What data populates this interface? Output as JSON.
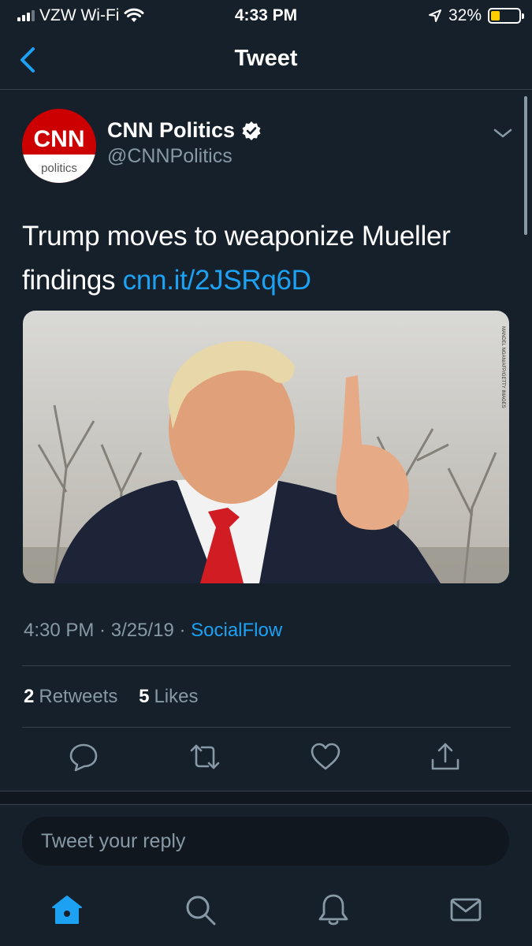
{
  "status_bar": {
    "carrier": "VZW Wi-Fi",
    "time": "4:33 PM",
    "battery_percent": "32%",
    "battery_level": 0.32,
    "battery_color": "#ffcc00"
  },
  "header": {
    "title": "Tweet"
  },
  "tweet": {
    "author": {
      "name": "CNN Politics",
      "handle": "@CNNPolitics",
      "avatar_logo_text": "CNN",
      "avatar_sub_text": "politics",
      "verified": true
    },
    "text": "Trump moves to weaponize Mueller findings ",
    "link": "cnn.it/2JSRq6D",
    "meta": {
      "time": "4:30 PM",
      "date": "3/25/19",
      "source": "SocialFlow",
      "separator": " · "
    },
    "stats": {
      "retweets_count": "2",
      "retweets_label": "Retweets",
      "likes_count": "5",
      "likes_label": "Likes"
    }
  },
  "actions": [
    "reply-icon",
    "retweet-icon",
    "like-icon",
    "share-icon"
  ],
  "reply": {
    "placeholder": "Tweet your reply"
  },
  "tabs": [
    "home-icon",
    "search-icon",
    "notifications-icon",
    "messages-icon"
  ],
  "colors": {
    "background": "#15202b",
    "accent": "#1da1f2",
    "secondary_text": "#8899a6",
    "divider": "#38444d",
    "cnn_red": "#cc0000"
  }
}
